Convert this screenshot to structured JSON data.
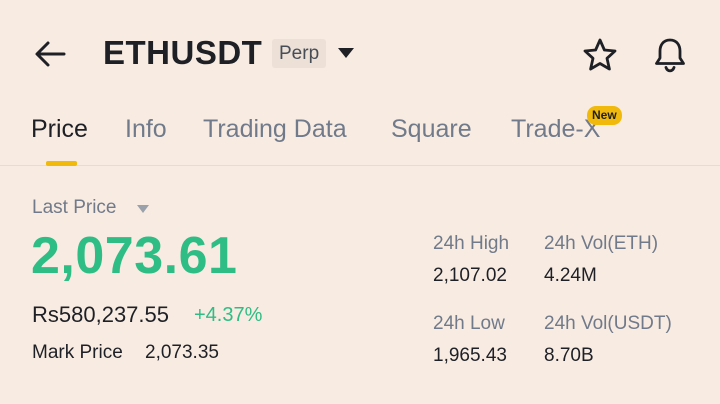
{
  "header": {
    "symbol": "ETHUSDT",
    "contract_type": "Perp"
  },
  "tabs": [
    {
      "label": "Price",
      "active": true
    },
    {
      "label": "Info"
    },
    {
      "label": "Trading Data"
    },
    {
      "label": "Square"
    },
    {
      "label": "Trade-X",
      "badge": "New"
    }
  ],
  "price": {
    "label": "Last Price",
    "last": "2,073.61",
    "fiat": "Rs580,237.55",
    "change": "+4.37%",
    "mark_label": "Mark Price",
    "mark_value": "2,073.35"
  },
  "stats": {
    "high_label": "24h High",
    "high_value": "2,107.02",
    "vol_eth_label": "24h Vol(ETH)",
    "vol_eth_value": "4.24M",
    "low_label": "24h Low",
    "low_value": "1,965.43",
    "vol_usdt_label": "24h Vol(USDT)",
    "vol_usdt_value": "8.70B"
  },
  "colors": {
    "background": "#f8ebe2",
    "positive": "#2ebd85",
    "accent": "#f0b90b",
    "muted": "#707a8a",
    "text": "#1e2026"
  },
  "icons": {
    "back": "arrow-left-icon",
    "dropdown": "caret-down-icon",
    "favorite": "star-icon",
    "notifications": "bell-icon"
  }
}
